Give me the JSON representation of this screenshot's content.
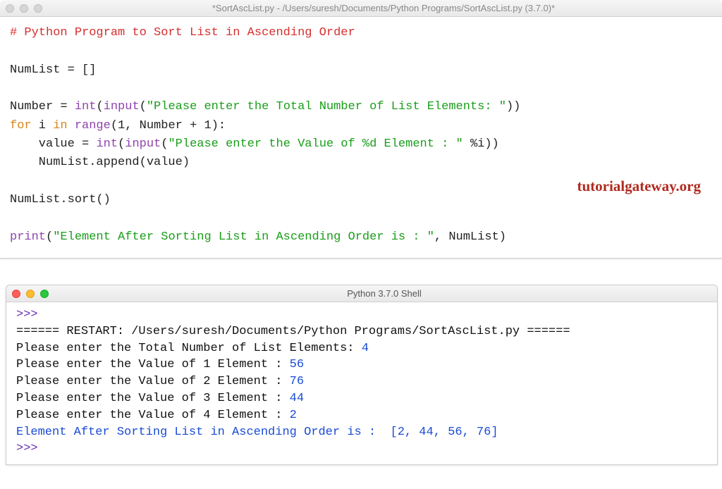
{
  "editor": {
    "title": "*SortAscList.py - /Users/suresh/Documents/Python Programs/SortAscList.py (3.7.0)*",
    "code": {
      "comment": "# Python Program to Sort List in Ascending Order",
      "l3a": "NumList ",
      "l3b": "=",
      "l3c": " []",
      "l5a": "Number ",
      "l5b": "=",
      "l5c": " ",
      "l5d": "int",
      "l5e": "(",
      "l5f": "input",
      "l5g": "(",
      "l5h": "\"Please enter the Total Number of List Elements: \"",
      "l5i": "))",
      "l6a": "for",
      "l6b": " i ",
      "l6c": "in",
      "l6d": " ",
      "l6e": "range",
      "l6f": "(",
      "l6g": "1",
      "l6h": ", Number ",
      "l6i": "+",
      "l6j": " ",
      "l6k": "1",
      "l6l": "):",
      "l7a": "    value ",
      "l7b": "=",
      "l7c": " ",
      "l7d": "int",
      "l7e": "(",
      "l7f": "input",
      "l7g": "(",
      "l7h": "\"Please enter the Value of %d Element : \"",
      "l7i": " ",
      "l7j": "%",
      "l7k": "i))",
      "l8": "    NumList.append(value)",
      "l10": "NumList.sort()",
      "l12a": "print",
      "l12b": "(",
      "l12c": "\"Element After Sorting List in Ascending Order is : \"",
      "l12d": ", NumList)"
    }
  },
  "watermark": "tutorialgateway.org",
  "shell": {
    "title": "Python 3.7.0 Shell",
    "prompt": ">>>",
    "restart": "====== RESTART: /Users/suresh/Documents/Python Programs/SortAscList.py ======",
    "lines": [
      {
        "prompt": "Please enter the Total Number of List Elements: ",
        "input": "4"
      },
      {
        "prompt": "Please enter the Value of 1 Element : ",
        "input": "56"
      },
      {
        "prompt": "Please enter the Value of 2 Element : ",
        "input": "76"
      },
      {
        "prompt": "Please enter the Value of 3 Element : ",
        "input": "44"
      },
      {
        "prompt": "Please enter the Value of 4 Element : ",
        "input": "2"
      }
    ],
    "result_label": "Element After Sorting List in Ascending Order is :  ",
    "result_value": "[2, 44, 56, 76]"
  }
}
